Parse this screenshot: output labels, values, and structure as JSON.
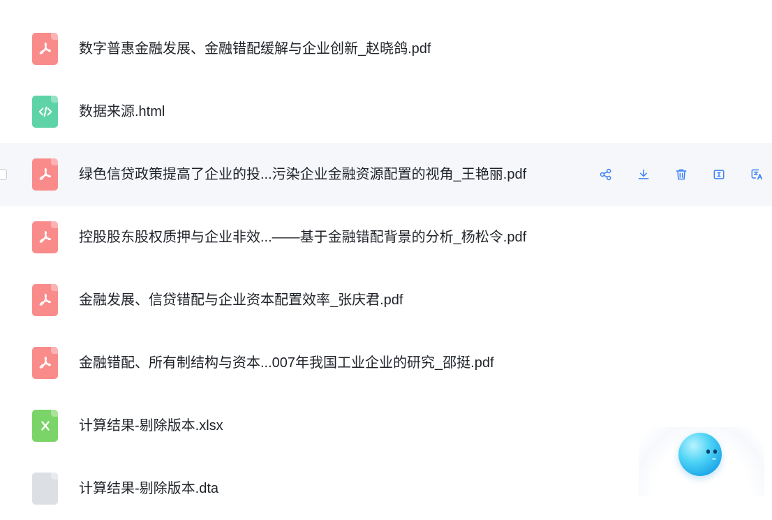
{
  "files": [
    {
      "type": "pdf",
      "icon": "pdf-icon",
      "name": "数字普惠金融发展、金融错配缓解与企业创新_赵晓鸽.pdf"
    },
    {
      "type": "html",
      "icon": "code-icon",
      "name": "数据来源.html"
    },
    {
      "type": "pdf",
      "icon": "pdf-icon",
      "name": "绿色信贷政策提高了企业的投...污染企业金融资源配置的视角_王艳丽.pdf"
    },
    {
      "type": "pdf",
      "icon": "pdf-icon",
      "name": "控股股东股权质押与企业非效...——基于金融错配背景的分析_杨松令.pdf"
    },
    {
      "type": "pdf",
      "icon": "pdf-icon",
      "name": "金融发展、信贷错配与企业资本配置效率_张庆君.pdf"
    },
    {
      "type": "pdf",
      "icon": "pdf-icon",
      "name": "金融错配、所有制结构与资本...007年我国工业企业的研究_邵挺.pdf"
    },
    {
      "type": "xlsx",
      "icon": "excel-icon",
      "name": "计算结果-剔除版本.xlsx"
    },
    {
      "type": "dta",
      "icon": "file-icon",
      "name": "计算结果-剔除版本.dta"
    }
  ],
  "hover_row_index": 2,
  "row_actions": [
    "share-icon",
    "download-icon",
    "delete-icon",
    "rename-icon",
    "translate-icon"
  ],
  "colors": {
    "pdf": "#fa8b8b",
    "html": "#5ed3a8",
    "xlsx": "#7bd468",
    "dta": "#dcdfe4",
    "accent": "#3b82f6"
  }
}
